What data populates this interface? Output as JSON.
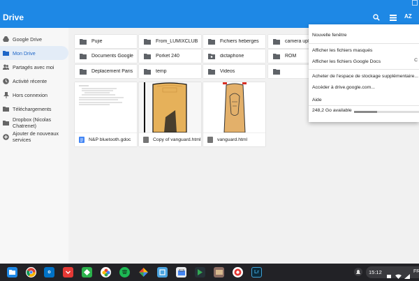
{
  "app": {
    "title": "Drive"
  },
  "toolbar": {
    "sort_label": "AZ",
    "icons": [
      "search-icon",
      "grid-view-icon",
      "sort-az-icon"
    ]
  },
  "sidebar": {
    "items": [
      {
        "label": "Google Drive",
        "icon": "drive-icon"
      },
      {
        "label": "Mon Drive",
        "icon": "folder-icon",
        "active": true
      },
      {
        "label": "Partagés avec moi",
        "icon": "people-icon"
      },
      {
        "label": "Activité récente",
        "icon": "clock-icon"
      },
      {
        "label": "Hors connexion",
        "icon": "pin-icon"
      },
      {
        "label": "Téléchargements",
        "icon": "download-icon"
      },
      {
        "label": "Dropbox (Nicolas Chatrenet)",
        "icon": "dropbox-icon"
      },
      {
        "label": "Ajouter de nouveaux services",
        "icon": "add-icon"
      }
    ]
  },
  "folders": [
    {
      "label": "Pujie",
      "icon": "folder-icon"
    },
    {
      "label": "From_LUMIXCLUB",
      "icon": "folder-icon"
    },
    {
      "label": "Fichiers heberges",
      "icon": "folder-icon"
    },
    {
      "label": "camera uplo",
      "icon": "folder-icon"
    },
    {
      "label": "Documents Google",
      "icon": "folder-icon"
    },
    {
      "label": "Porket 240",
      "icon": "folder-icon"
    },
    {
      "label": "dictaphone",
      "icon": "shared-folder-icon"
    },
    {
      "label": "ROM",
      "icon": "folder-icon"
    },
    {
      "label": "Deplacement Paris",
      "icon": "folder-icon"
    },
    {
      "label": "temp",
      "icon": "folder-icon"
    },
    {
      "label": "Videos",
      "icon": "folder-icon"
    },
    {
      "label": "",
      "icon": "folder-icon"
    }
  ],
  "files": [
    {
      "label": "N&P bluetooth.gdoc",
      "icon": "gdoc-icon"
    },
    {
      "label": "Copy of vanguard.html",
      "icon": "html-file-icon"
    },
    {
      "label": "vanguard.html",
      "icon": "html-file-icon"
    }
  ],
  "menu": {
    "items": [
      "Nouvelle fenêtre",
      "Afficher les fichiers masqués",
      "Afficher les fichiers Google Docs",
      "Acheter de l'espace de stockage supplémentaire...",
      "Accéder à drive.google.com...",
      "Aide"
    ],
    "shortcut": "C",
    "storage_label": "248,2 Go available",
    "storage_used_fraction": 0.35
  },
  "shelf": {
    "apps": [
      "files-icon",
      "chrome-icon",
      "outlook-icon",
      "pocket-icon",
      "feedly-icon",
      "photos-icon",
      "spotify-icon",
      "google-photos-icon",
      "screenshot-icon",
      "store-icon",
      "play-store-icon",
      "wallet-icon",
      "camera-icon",
      "lightroom-icon"
    ],
    "lightroom_label": "Lr",
    "time": "15:12",
    "locale": "FR"
  },
  "colors": {
    "accent": "#1e88e5",
    "active": "#1e66c7"
  }
}
